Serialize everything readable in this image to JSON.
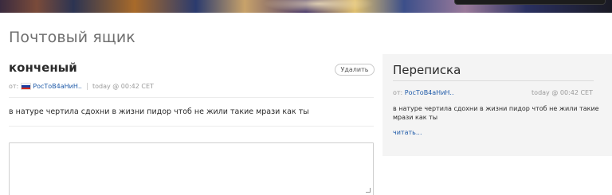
{
  "page": {
    "title": "Почтовый ящик"
  },
  "message": {
    "subject": "конченый",
    "delete_label": "Удалить",
    "from_prefix": "от:",
    "author": "РосТоВ4аНиН..",
    "time": "today @ 00:42 CET",
    "body": "в натуре чертила сдохни в жизни пидор чтоб не жили такие мрази как ты",
    "flag_colors": [
      "#ffffff",
      "#1c3fa0",
      "#d52b1e"
    ]
  },
  "reply": {
    "value": "",
    "placeholder": ""
  },
  "conversation": {
    "title": "Переписка",
    "items": [
      {
        "from_prefix": "от:",
        "author": "РосТоВ4аНиН..",
        "time": "today @ 00:42 CET",
        "text": "в натуре чертила сдохни в жизни пидор чтоб не жили такие мрази как ты",
        "read_label": "читать..."
      }
    ]
  },
  "colors": {
    "link": "#1e5aa8",
    "muted": "#9a9a9a",
    "sidebar_bg": "#f4f4f4"
  }
}
